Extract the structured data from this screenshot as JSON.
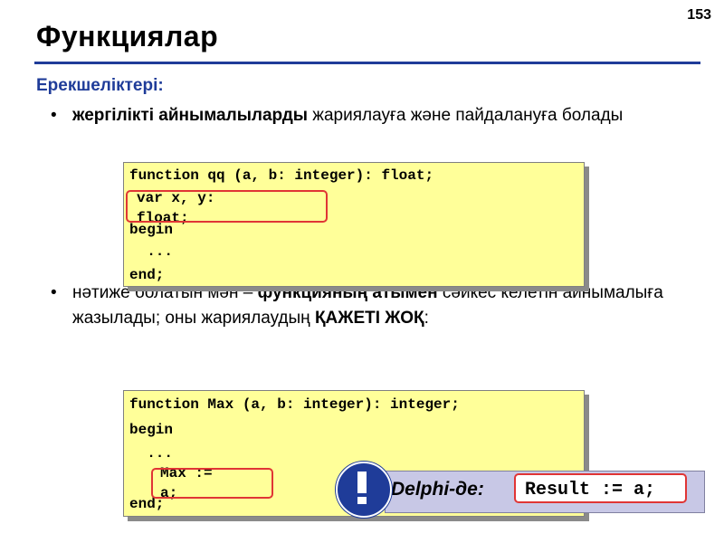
{
  "page_number": "153",
  "title": "Функциялар",
  "subtitle": "Ерекшеліктері:",
  "bullet1": {
    "bold": "жергілікті айнымалыларды",
    "rest": " жариялауға және пайдалануға болады"
  },
  "bullet2": {
    "start": "нәтиже болатын мән – ",
    "bold_hidden": "функцияның атымен",
    "rest": " сәйкес келетін айнымалыға жазылады; оны жариялаудың ",
    "bold_end": "ҚАЖЕТІ ЖОҚ",
    "colon": ":"
  },
  "code1": {
    "line1": "function qq (a, b: integer): float;",
    "var1": "var x, y:",
    "var2": "float;",
    "line3": "begin",
    "line4": "  ...",
    "line5": "end;"
  },
  "code2": {
    "line1": "function Max (a, b: integer): integer;",
    "line2": "begin",
    "line3": "  ...",
    "max1": "Max :=",
    "max2": "a;",
    "line5": "end;"
  },
  "delphi": {
    "label": "Delphi-де:",
    "code": "Result := a;"
  },
  "icons": {
    "warning": "exclamation-icon"
  },
  "colors": {
    "accent": "#1f3c99",
    "code_bg": "#ffff99",
    "highlight": "#e03535",
    "delphi_bg": "#c8c8e6"
  }
}
